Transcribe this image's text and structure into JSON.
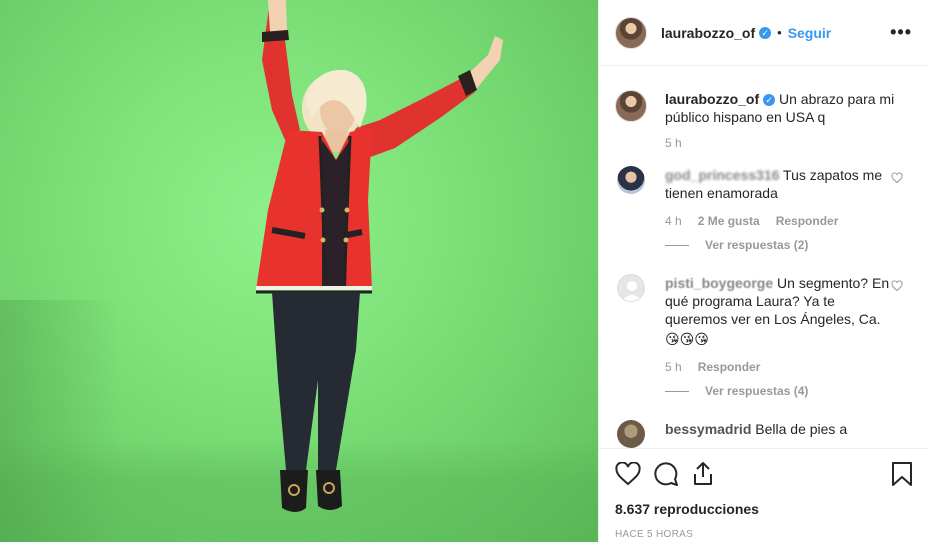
{
  "post": {
    "username": "laurabozzo_of",
    "follow_label": "Seguir",
    "dot": "•",
    "more": "•••"
  },
  "comments": [
    {
      "username": "laurabozzo_of",
      "text": "Un abrazo para mi público hispano en USA q",
      "time": "5 h"
    },
    {
      "username": "god_princess316",
      "text": "Tus zapatos me tienen enamorada",
      "time": "4 h",
      "likes": "2 Me gusta",
      "reply_label": "Responder",
      "view_replies": "Ver respuestas (2)"
    },
    {
      "username": "pisti_boygeorge",
      "text": "Un segmento? En qué programa Laura? Ya te queremos ver en Los Ángeles, Ca.",
      "emojis": "😘😘😘",
      "time": "5 h",
      "reply_label": "Responder",
      "view_replies": "Ver respuestas (4)"
    },
    {
      "username": "bessymadrid",
      "text": "Bella de pies a"
    }
  ],
  "stats": {
    "views": "8.637 reproducciones",
    "posted": "HACE 5 HORAS"
  },
  "icons": [
    "heart-icon",
    "comment-icon",
    "share-icon",
    "bookmark-icon",
    "verified-icon",
    "more-options-icon"
  ],
  "colors": {
    "accent": "#3897f0",
    "green_screen": "#7fe27a",
    "jacket": "#e8322e"
  }
}
